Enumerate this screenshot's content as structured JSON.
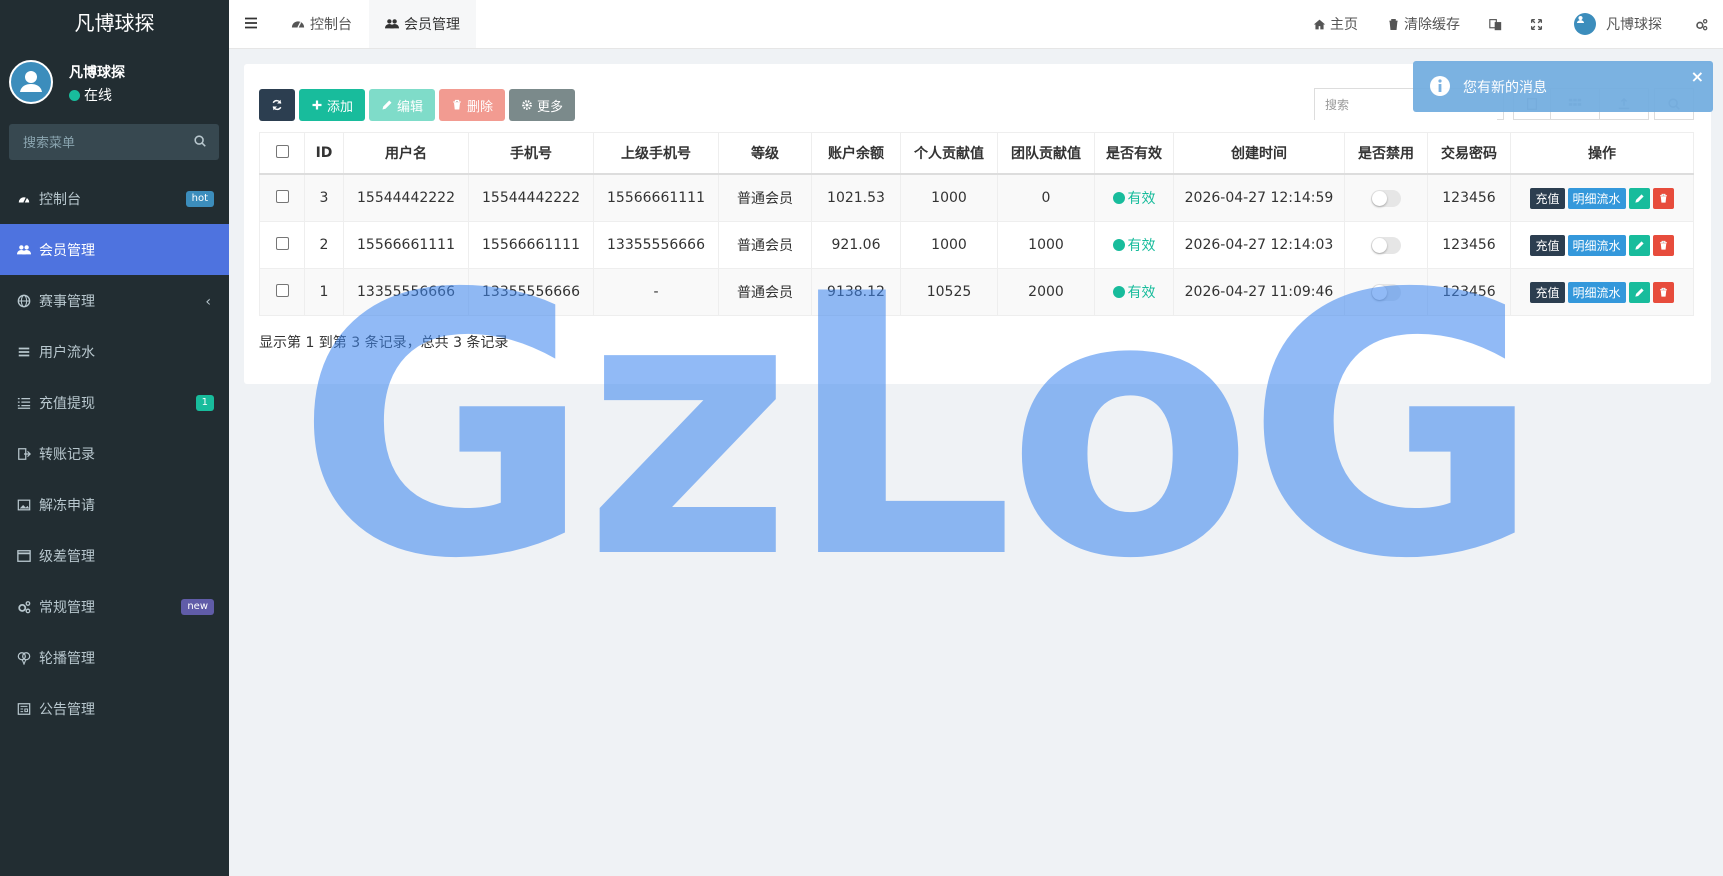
{
  "brand": "凡博球探",
  "user": {
    "name": "凡博球探",
    "status": "在线"
  },
  "sidebar": {
    "search_placeholder": "搜索菜单",
    "items": [
      {
        "label": "控制台",
        "icon": "dashboard-icon",
        "badge": "hot"
      },
      {
        "label": "会员管理",
        "icon": "users-icon",
        "active": true
      },
      {
        "label": "赛事管理",
        "icon": "globe-icon"
      },
      {
        "label": "用户流水",
        "icon": "bars-icon"
      },
      {
        "label": "充值提现",
        "icon": "list-icon",
        "badge": "1"
      },
      {
        "label": "转账记录",
        "icon": "transfer-icon"
      },
      {
        "label": "解冻申请",
        "icon": "image-icon"
      },
      {
        "label": "级差管理",
        "icon": "window-icon"
      },
      {
        "label": "常规管理",
        "icon": "cogs-icon",
        "badge": "new"
      },
      {
        "label": "轮播管理",
        "icon": "balloon-icon"
      },
      {
        "label": "公告管理",
        "icon": "newspaper-icon"
      }
    ]
  },
  "navbar": {
    "tabs": [
      {
        "label": "控制台",
        "icon": "dashboard-icon"
      },
      {
        "label": "会员管理",
        "icon": "users-icon",
        "active": true
      }
    ],
    "home": "主页",
    "clear_cache": "清除缓存",
    "username": "凡博球探"
  },
  "toolbar": {
    "add": "添加",
    "edit": "编辑",
    "delete": "删除",
    "more": "更多",
    "search_placeholder": "搜索"
  },
  "table": {
    "headers": [
      "ID",
      "用户名",
      "手机号",
      "上级手机号",
      "等级",
      "账户余额",
      "个人贡献值",
      "团队贡献值",
      "是否有效",
      "创建时间",
      "是否禁用",
      "交易密码",
      "操作"
    ],
    "rows": [
      {
        "id": "3",
        "username": "15544442222",
        "phone": "15544442222",
        "parent_phone": "15566661111",
        "level": "普通会员",
        "balance": "1021.53",
        "personal": "1000",
        "team": "0",
        "valid": "有效",
        "created": "2026-04-27 12:14:59",
        "disabled": false,
        "trade_pwd": "123456"
      },
      {
        "id": "2",
        "username": "15566661111",
        "phone": "15566661111",
        "parent_phone": "13355556666",
        "level": "普通会员",
        "balance": "921.06",
        "personal": "1000",
        "team": "1000",
        "valid": "有效",
        "created": "2026-04-27 12:14:03",
        "disabled": false,
        "trade_pwd": "123456"
      },
      {
        "id": "1",
        "username": "13355556666",
        "phone": "13355556666",
        "parent_phone": "-",
        "level": "普通会员",
        "balance": "9138.12",
        "personal": "10525",
        "team": "2000",
        "valid": "有效",
        "created": "2026-04-27 11:09:46",
        "disabled": false,
        "trade_pwd": "123456"
      }
    ],
    "op_labels": {
      "charge": "充值",
      "flow": "明细流水"
    }
  },
  "pagination_info": "显示第 1 到第 3 条记录，总共 3 条记录",
  "toast": {
    "message": "您有新的消息"
  },
  "watermark": "GzLoG",
  "colors": {
    "sidebar": "#222d32",
    "active": "#4e73df",
    "success": "#18bc9c",
    "danger": "#e74c3c"
  }
}
